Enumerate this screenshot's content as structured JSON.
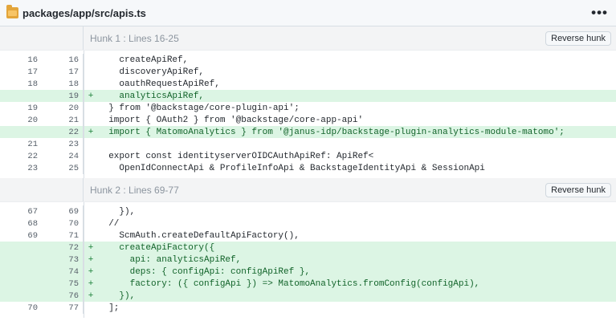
{
  "file": {
    "path": "packages/app/src/apis.ts",
    "menu_icon": "more-horizontal-icon",
    "menu_label": "•••"
  },
  "hunks": [
    {
      "label": "Hunk 1 : Lines 16-25",
      "button_label": "Reverse hunk",
      "lines": [
        {
          "old": "16",
          "new": "16",
          "marker": "",
          "code": "    createApiRef,",
          "added": false
        },
        {
          "old": "17",
          "new": "17",
          "marker": "",
          "code": "    discoveryApiRef,",
          "added": false
        },
        {
          "old": "18",
          "new": "18",
          "marker": "",
          "code": "    oauthRequestApiRef,",
          "added": false
        },
        {
          "old": "",
          "new": "19",
          "marker": "+",
          "code": "    analyticsApiRef,",
          "added": true
        },
        {
          "old": "19",
          "new": "20",
          "marker": "",
          "code": "  } from '@backstage/core-plugin-api';",
          "added": false
        },
        {
          "old": "20",
          "new": "21",
          "marker": "",
          "code": "  import { OAuth2 } from '@backstage/core-app-api'",
          "added": false
        },
        {
          "old": "",
          "new": "22",
          "marker": "+",
          "code": "  import { MatomoAnalytics } from '@janus-idp/backstage-plugin-analytics-module-matomo';",
          "added": true
        },
        {
          "old": "21",
          "new": "23",
          "marker": "",
          "code": "",
          "added": false
        },
        {
          "old": "22",
          "new": "24",
          "marker": "",
          "code": "  export const identityserverOIDCAuthApiRef: ApiRef<",
          "added": false
        },
        {
          "old": "23",
          "new": "25",
          "marker": "",
          "code": "    OpenIdConnectApi & ProfileInfoApi & BackstageIdentityApi & SessionApi",
          "added": false
        }
      ]
    },
    {
      "label": "Hunk 2 : Lines 69-77",
      "button_label": "Reverse hunk",
      "lines": [
        {
          "old": "67",
          "new": "69",
          "marker": "",
          "code": "    }),",
          "added": false
        },
        {
          "old": "68",
          "new": "70",
          "marker": "",
          "code": "  //",
          "added": false
        },
        {
          "old": "69",
          "new": "71",
          "marker": "",
          "code": "    ScmAuth.createDefaultApiFactory(),",
          "added": false
        },
        {
          "old": "",
          "new": "72",
          "marker": "+",
          "code": "    createApiFactory({",
          "added": true
        },
        {
          "old": "",
          "new": "73",
          "marker": "+",
          "code": "      api: analyticsApiRef,",
          "added": true
        },
        {
          "old": "",
          "new": "74",
          "marker": "+",
          "code": "      deps: { configApi: configApiRef },",
          "added": true
        },
        {
          "old": "",
          "new": "75",
          "marker": "+",
          "code": "      factory: ({ configApi }) => MatomoAnalytics.fromConfig(configApi),",
          "added": true
        },
        {
          "old": "",
          "new": "76",
          "marker": "+",
          "code": "    }),",
          "added": true
        },
        {
          "old": "70",
          "new": "77",
          "marker": "",
          "code": "  ];",
          "added": false
        }
      ]
    }
  ]
}
